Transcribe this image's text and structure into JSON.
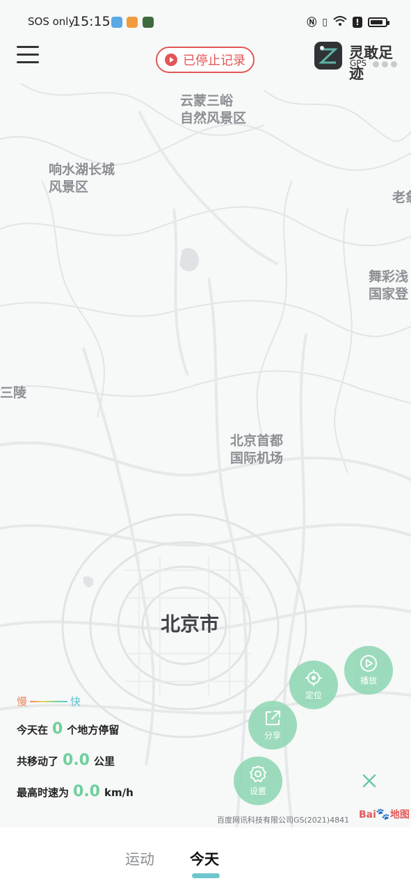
{
  "status_bar": {
    "carrier": "SOS only",
    "time": "15:15",
    "icons": [
      "weather-app-icon",
      "news-app-icon",
      "fitness-app-icon",
      "nfc-icon",
      "vibrate-icon",
      "wifi-icon",
      "alert-icon",
      "battery-icon"
    ]
  },
  "header": {
    "menu_icon": "menu-icon",
    "record_status": "已停止记录",
    "brand_name": "灵敢足迹",
    "brand_sub": "GPS"
  },
  "map": {
    "places": [
      {
        "name": "云蒙三峪\n自然风景区"
      },
      {
        "name": "响水湖长城\n风景区"
      },
      {
        "name": "老象"
      },
      {
        "name": "舞彩浅\n国家登"
      },
      {
        "name": "三陵"
      },
      {
        "name": "北京首都\n国际机场"
      }
    ],
    "city": "北京市",
    "copyright": "百度网讯科技有限公司GS(2021)4841",
    "baidu_logo": "Bai地图"
  },
  "legend": {
    "slow": "慢",
    "fast": "快"
  },
  "stats": {
    "stay_prefix": "今天在",
    "stay_count": "0",
    "stay_suffix": "个地方停留",
    "move_prefix": "共移动了",
    "move_value": "0.0",
    "move_unit": "公里",
    "speed_prefix": "最高时速为",
    "speed_value": "0.0",
    "speed_unit": "km/h"
  },
  "actions": {
    "locate": "定位",
    "play": "播放",
    "share": "分享",
    "settings": "设置"
  },
  "bottom_nav": {
    "tabs": [
      {
        "label": "运动",
        "active": false
      },
      {
        "label": "今天",
        "active": true
      }
    ]
  },
  "colors": {
    "accent_green": "#8fd8b4",
    "record_red": "#e25656",
    "tab_indicator": "#6cc6cc"
  }
}
